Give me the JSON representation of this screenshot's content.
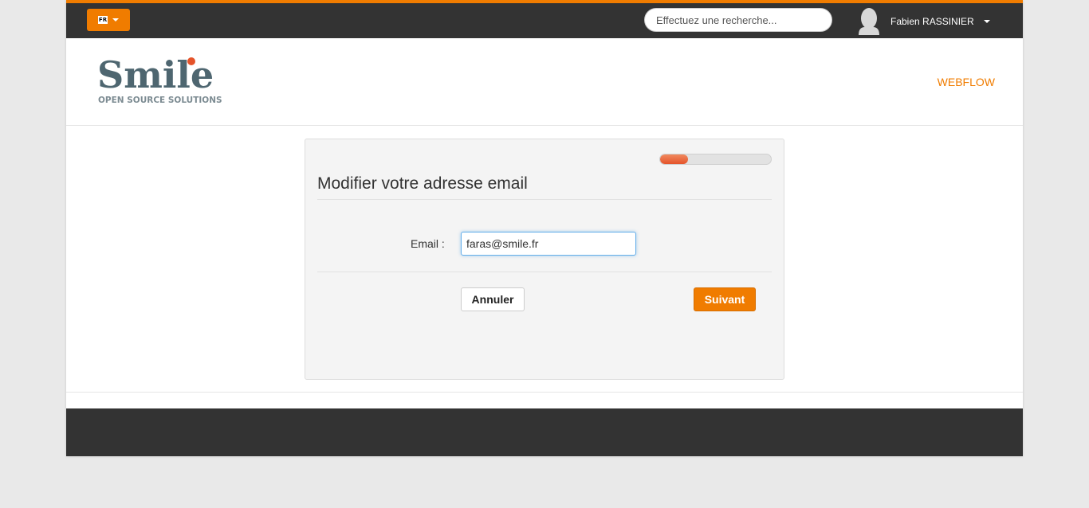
{
  "topbar": {
    "language": {
      "code": "FR"
    },
    "search": {
      "placeholder": "Effectuez une recherche...",
      "value": ""
    },
    "user": {
      "name": "Fabien RASSINIER"
    }
  },
  "header": {
    "logo": {
      "name": "Smile",
      "tagline": "OPEN SOURCE SOLUTIONS"
    },
    "nav": [
      {
        "label": "WEBFLOW"
      }
    ]
  },
  "form": {
    "title": "Modifier votre adresse email",
    "progress": 0.25,
    "email": {
      "label": "Email :",
      "value": "faras@smile.fr"
    },
    "cancel_label": "Annuler",
    "next_label": "Suivant"
  },
  "colors": {
    "accent": "#f07c00",
    "topbar": "#333333",
    "progress_fill": "#e5532a",
    "logo_text": "#4e6670"
  },
  "icons": {
    "language_flag": "flag-icon",
    "dropdown": "caret-down-icon",
    "avatar": "user-avatar-icon"
  }
}
